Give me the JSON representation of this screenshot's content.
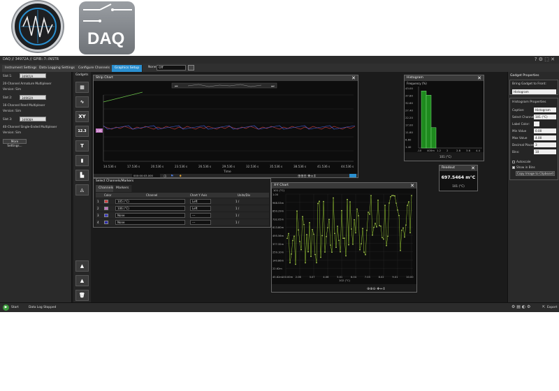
{
  "app": {
    "title": "DAQ // 34972A // GPIB::7::INSTR",
    "tabs": [
      "Instrument Settings",
      "Data Logging Settings",
      "Configure Channels",
      "Graphics Setup"
    ],
    "none_label": "None",
    "off_value": "Off"
  },
  "left": {
    "slots": [
      {
        "label": "Slot 1:",
        "value": "34901A",
        "desc": "20-Channel Armature Multiplexer",
        "version": "Version: Sim"
      },
      {
        "label": "Slot 2:",
        "value": "34902A",
        "desc": "16-Channel Reed Multiplexer",
        "version": "Version: Sim"
      },
      {
        "label": "Slot 3:",
        "value": "34908A",
        "desc": "40-Channel Single-Ended Multiplexer",
        "version": "Version: Sim"
      }
    ],
    "more_settings": "More Settings..."
  },
  "gadgets": {
    "header": "Gadgets",
    "xy_label": "XY",
    "num_label": "12.3",
    "text_label": "T"
  },
  "strip_chart": {
    "title": "Strip Chart",
    "x_ticks": [
      "14.536 s",
      "17.536 s",
      "20.536 s",
      "23.536 s",
      "26.536 s",
      "29.536 s",
      "32.536 s",
      "35.536 s",
      "38.536 s",
      "41.536 s",
      "44.536 s"
    ],
    "x_label": "Time",
    "marker_value": "106",
    "time_field": "000:00:03.000"
  },
  "channels_panel": {
    "header": "Select Channels/Markers",
    "tabs": [
      "Channels",
      "Markers"
    ],
    "columns": [
      "Color",
      "Channel",
      "Chart Y Axis",
      "Units/Div"
    ],
    "rows": [
      {
        "num": "1",
        "color": "#d04040",
        "channel": "105 (°C)",
        "axis": "Left",
        "units": "1 /"
      },
      {
        "num": "2",
        "color": "#c070c0",
        "channel": "106 (°C)",
        "axis": "Left",
        "units": "1 /"
      },
      {
        "num": "3",
        "color": "#3a3ac0",
        "channel": "None",
        "axis": "---",
        "units": "1 /"
      },
      {
        "num": "4",
        "color": "#2a2aa8",
        "channel": "None",
        "axis": "---",
        "units": "1 /"
      }
    ]
  },
  "histogram": {
    "title": "Histogram",
    "y_label": "Frequency (%)",
    "y_ticks": [
      "43.00",
      "37.80",
      "32.60",
      "27.40",
      "22.20",
      "17.00",
      "11.80",
      "6.60",
      "1.40"
    ],
    "x_ticks": [
      "-10",
      "400m",
      "1.2",
      "2",
      "2.8",
      "3.6",
      "4.4"
    ],
    "x_label": "101 (°C)",
    "bin_heights": [
      0.95,
      0.88,
      0.34
    ]
  },
  "readout": {
    "title": "Readout",
    "value": "697.5464 m°C",
    "channel": "101 (°C)"
  },
  "xy_chart": {
    "title": "X-Y Chart",
    "y_label": "101 (°C)",
    "y_ticks": [
      "1.00",
      "968.53m",
      "850.29m",
      "732.05m",
      "613.80m",
      "495.56m",
      "377.32m",
      "259.10m",
      "140.86m",
      "22.62m",
      "45.62m"
    ],
    "x_ticks": [
      "100.00m",
      "2.06",
      "3.07",
      "4.06",
      "5.01",
      "6.04",
      "7.03",
      "8.02",
      "9.01",
      "10.00"
    ],
    "x_label": "102 (°C)"
  },
  "right": {
    "gadget_properties": "Gadget Properties",
    "bring_front": "Bring Gadget to Front:",
    "bring_value": "Histogram",
    "hist_props": "Histogram Properties",
    "fields": [
      {
        "label": "Caption:",
        "value": "Histogram"
      },
      {
        "label": "Select Channel:",
        "value": "101 (°C)"
      },
      {
        "label": "Label Color:",
        "value": ""
      },
      {
        "label": "Min Value",
        "value": "0.00"
      },
      {
        "label": "Max Value",
        "value": "4.00"
      },
      {
        "label": "Decimal Places",
        "value": "3"
      },
      {
        "label": "Bins:",
        "value": "10"
      }
    ],
    "autoscale": "Autoscale",
    "show_bins": "Show in Bins",
    "copy": "Copy Image to Clipboard"
  },
  "status": {
    "start": "Start",
    "log": "Data Log Stopped",
    "export": "Export"
  },
  "colors": {
    "accent": "#2a8fd0",
    "green": "#9acd32",
    "trace_red": "#d04040",
    "trace_blue": "#4060e0"
  }
}
